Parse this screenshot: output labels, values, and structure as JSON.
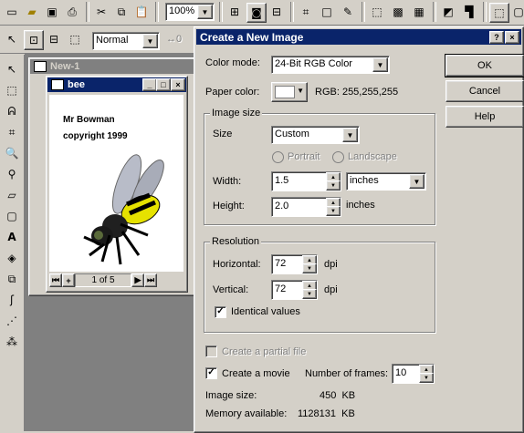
{
  "toolbar": {
    "zoom_value": "100%"
  },
  "toolbar2": {
    "mode_value": "Normal"
  },
  "window_new": {
    "title": "New-1"
  },
  "window_bee": {
    "title": "bee",
    "text_line1": "Mr Bowman",
    "text_line2": "copyright 1999",
    "page_indicator": "1 of 5"
  },
  "dialog": {
    "title": "Create a New Image",
    "help_glyph": "?",
    "close_glyph": "×",
    "color_mode_label": "Color mode:",
    "color_mode_value": "24-Bit RGB Color",
    "paper_color_label": "Paper color:",
    "paper_color_rgb": "RGB: 255,255,255",
    "image_size_group": "Image size",
    "size_label": "Size",
    "size_value": "Custom",
    "portrait_label": "Portrait",
    "landscape_label": "Landscape",
    "width_label": "Width:",
    "width_value": "1.5",
    "width_unit": "inches",
    "height_label": "Height:",
    "height_value": "2.0",
    "height_unit": "inches",
    "resolution_group": "Resolution",
    "horizontal_label": "Horizontal:",
    "horizontal_value": "72",
    "horizontal_unit": "dpi",
    "vertical_label": "Vertical:",
    "vertical_value": "72",
    "vertical_unit": "dpi",
    "identical_label": "Identical values",
    "partial_label": "Create a partial file",
    "movie_label": "Create a movie",
    "frames_label": "Number of frames:",
    "frames_value": "10",
    "image_size_label": "Image size:",
    "image_size_value": "450  KB",
    "memory_label": "Memory available:",
    "memory_value": "1128131  KB",
    "ok_label": "OK",
    "cancel_label": "Cancel",
    "help_label": "Help"
  },
  "colors": {
    "active_title": "#0a246a",
    "face": "#d4d0c8",
    "workspace": "#808080"
  }
}
